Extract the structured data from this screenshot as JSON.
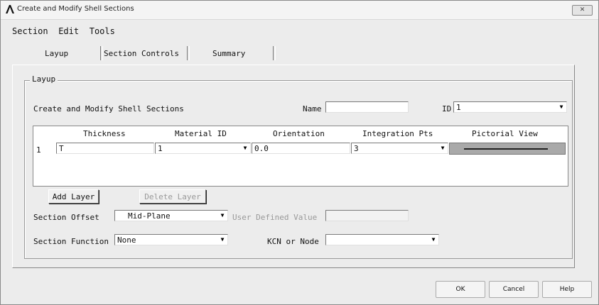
{
  "window": {
    "title": "Create and Modify Shell Sections",
    "close_label": "✕"
  },
  "menu": {
    "items": [
      "Section",
      "Edit",
      "Tools"
    ]
  },
  "tabs": [
    "Layup",
    "Section Controls",
    "Summary"
  ],
  "group": {
    "label": "Layup"
  },
  "form": {
    "heading": "Create and Modify Shell Sections",
    "name_label": "Name",
    "name_value": "",
    "id_label": "ID",
    "id_value": "1"
  },
  "table": {
    "headers": [
      "Thickness",
      "Material ID",
      "Orientation",
      "Integration Pts",
      "Pictorial View"
    ],
    "rows": [
      {
        "index": "1",
        "thickness": "T",
        "material_id": "1",
        "orientation": "0.0",
        "integration_pts": "3"
      }
    ]
  },
  "buttons": {
    "add_layer": "Add Layer",
    "delete_layer": "Delete Layer",
    "ok": "OK",
    "cancel": "Cancel",
    "help": "Help"
  },
  "offset": {
    "label": "Section Offset",
    "value": "Mid-Plane",
    "user_value_label": "User Defined Value",
    "user_value": ""
  },
  "function": {
    "label": "Section Function",
    "value": "None",
    "kcn_label": "KCN or Node",
    "kcn_value": ""
  }
}
